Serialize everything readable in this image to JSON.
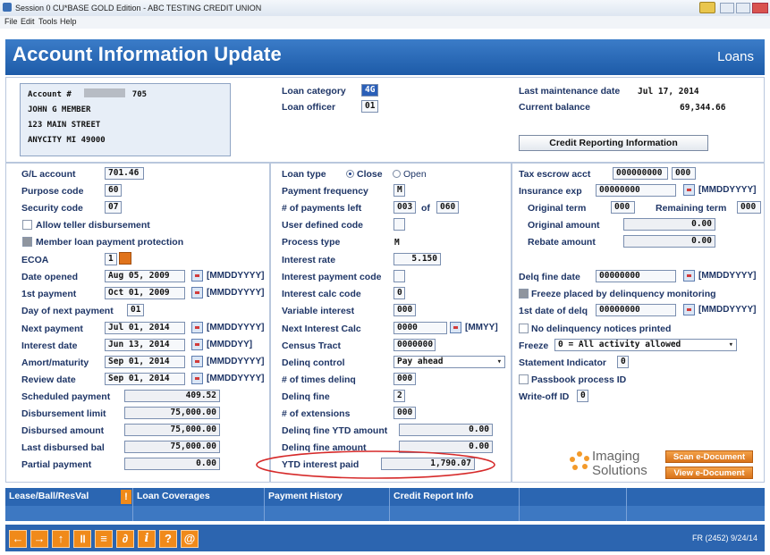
{
  "window": {
    "title": "Session 0 CU*BASE GOLD Edition - ABC TESTING CREDIT UNION"
  },
  "menu": [
    "File",
    "Edit",
    "Tools",
    "Help"
  ],
  "header": {
    "title": "Account Information Update",
    "section": "Loans"
  },
  "account": {
    "label": "Account #",
    "suffix": "705",
    "name": "JOHN G MEMBER",
    "street": "123 MAIN STREET",
    "city": "ANYCITY MI 49000"
  },
  "top_mid": {
    "loan_category_label": "Loan category",
    "loan_category": "4G",
    "loan_officer_label": "Loan officer",
    "loan_officer": "01"
  },
  "top_right": {
    "last_maint_label": "Last maintenance date",
    "last_maint": "Jul 17, 2014",
    "balance_label": "Current balance",
    "balance": "69,344.66",
    "credit_button": "Credit Reporting Information"
  },
  "left": {
    "gl_label": "G/L account",
    "gl": "701.46",
    "purpose_label": "Purpose code",
    "purpose": "60",
    "security_label": "Security code",
    "security": "07",
    "allow_teller": "Allow teller disbursement",
    "member_protection": "Member loan payment protection",
    "ecoa_label": "ECOA",
    "ecoa": "1",
    "opened_label": "Date opened",
    "opened": "Aug 05, 2009",
    "opened_fmt": "[MMDDYYYY]",
    "first_label": "1st payment",
    "first": "Oct 01, 2009",
    "first_fmt": "[MMDDYYYY]",
    "day_next_label": "Day of next payment",
    "day_next": "01",
    "next_label": "Next payment",
    "next": "Jul 01, 2014",
    "next_fmt": "[MMDDYYYY]",
    "int_date_label": "Interest date",
    "int_date": "Jun 13, 2014",
    "int_date_fmt": "[MMDDYY]",
    "amort_label": "Amort/maturity",
    "amort": "Sep 01, 2014",
    "amort_fmt": "[MMDDYYYY]",
    "review_label": "Review date",
    "review": "Sep 01, 2014",
    "review_fmt": "[MMDDYYYY]",
    "sched_label": "Scheduled payment",
    "sched": "409.52",
    "disb_limit_label": "Disbursement limit",
    "disb_limit": "75,000.00",
    "disb_amt_label": "Disbursed amount",
    "disb_amt": "75,000.00",
    "last_disb_label": "Last disbursed bal",
    "last_disb": "75,000.00",
    "partial_label": "Partial payment",
    "partial": "0.00"
  },
  "mid": {
    "loan_type_label": "Loan type",
    "close": "Close",
    "open": "Open",
    "freq_label": "Payment frequency",
    "freq": "M",
    "left_label": "# of payments left",
    "left": "003",
    "of": "of",
    "total": "060",
    "udc_label": "User defined code",
    "proc_label": "Process type",
    "proc": "M",
    "rate_label": "Interest rate",
    "rate": "5.150",
    "ipc_label": "Interest payment code",
    "icc_label": "Interest calc code",
    "icc": "0",
    "var_label": "Variable interest",
    "var": "000",
    "nic_label": "Next Interest Calc",
    "nic": "0000",
    "nic_fmt": "[MMYY]",
    "census_label": "Census Tract",
    "census": "0000000",
    "delinq_ctrl_label": "Delinq control",
    "delinq_ctrl": "Pay ahead",
    "times_label": "# of times delinq",
    "times": "000",
    "fine_label": "Delinq fine",
    "fine": "2",
    "ext_label": "# of extensions",
    "ext": "000",
    "fine_ytd_label": "Delinq fine YTD amount",
    "fine_ytd": "0.00",
    "fine_amt_label": "Delinq fine amount",
    "fine_amt": "0.00",
    "ytd_int_label": "YTD interest paid",
    "ytd_int": "1,790.07"
  },
  "right": {
    "tax_label": "Tax escrow acct",
    "tax1": "000000000",
    "tax2": "000",
    "ins_label": "Insurance exp",
    "ins": "00000000",
    "ins_fmt": "[MMDDYYYY]",
    "orig_term_label": "Original term",
    "orig_term": "000",
    "rem_term_label": "Remaining term",
    "rem_term": "000",
    "orig_amt_label": "Original amount",
    "orig_amt": "0.00",
    "rebate_label": "Rebate amount",
    "rebate": "0.00",
    "fine_date_label": "Delq fine date",
    "fine_date": "00000000",
    "fine_date_fmt": "[MMDDYYYY]",
    "freeze_placed": "Freeze placed by delinquency monitoring",
    "first_delq_label": "1st date of delq",
    "first_delq": "00000000",
    "first_delq_fmt": "[MMDDYYYY]",
    "no_notices": "No delinquency notices printed",
    "freeze_label": "Freeze",
    "freeze": "0 = All activity allowed",
    "stmt_label": "Statement Indicator",
    "stmt": "0",
    "passbook": "Passbook process ID",
    "writeoff_label": "Write-off ID",
    "writeoff": "0",
    "logo_top": "Imaging",
    "logo_bottom": "Solutions",
    "scan_btn": "Scan e-Document",
    "view_btn": "View e-Document"
  },
  "tabs": [
    "Lease/Ball/ResVal",
    "Loan Coverages",
    "Payment History",
    "Credit Report Info"
  ],
  "status": "FR (2452) 9/24/14",
  "colors": {
    "header": "#2a6bbf",
    "accent": "#f08a1a",
    "highlight_circle": "#d62a2a"
  }
}
